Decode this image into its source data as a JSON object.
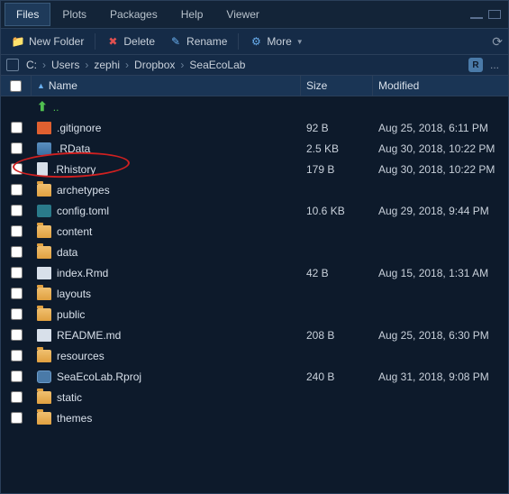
{
  "tabs": [
    "Files",
    "Plots",
    "Packages",
    "Help",
    "Viewer"
  ],
  "active_tab": 0,
  "toolbar": {
    "new_folder": "New Folder",
    "delete": "Delete",
    "rename": "Rename",
    "more": "More"
  },
  "breadcrumbs": [
    "C:",
    "Users",
    "zephi",
    "Dropbox",
    "SeaEcoLab"
  ],
  "columns": {
    "name": "Name",
    "size": "Size",
    "modified": "Modified"
  },
  "files": [
    {
      "name": "..",
      "type": "up",
      "size": "",
      "modified": ""
    },
    {
      "name": ".gitignore",
      "type": "git",
      "size": "92 B",
      "modified": "Aug 25, 2018, 6:11 PM"
    },
    {
      "name": ".RData",
      "type": "r",
      "size": "2.5 KB",
      "modified": "Aug 30, 2018, 10:22 PM"
    },
    {
      "name": ".Rhistory",
      "type": "file",
      "size": "179 B",
      "modified": "Aug 30, 2018, 10:22 PM"
    },
    {
      "name": "archetypes",
      "type": "folder",
      "size": "",
      "modified": ""
    },
    {
      "name": "config.toml",
      "type": "toml",
      "size": "10.6 KB",
      "modified": "Aug 29, 2018, 9:44 PM"
    },
    {
      "name": "content",
      "type": "folder",
      "size": "",
      "modified": ""
    },
    {
      "name": "data",
      "type": "folder",
      "size": "",
      "modified": ""
    },
    {
      "name": "index.Rmd",
      "type": "md",
      "size": "42 B",
      "modified": "Aug 15, 2018, 1:31 AM"
    },
    {
      "name": "layouts",
      "type": "folder",
      "size": "",
      "modified": ""
    },
    {
      "name": "public",
      "type": "folder",
      "size": "",
      "modified": ""
    },
    {
      "name": "README.md",
      "type": "md",
      "size": "208 B",
      "modified": "Aug 25, 2018, 6:30 PM"
    },
    {
      "name": "resources",
      "type": "folder",
      "size": "",
      "modified": ""
    },
    {
      "name": "SeaEcoLab.Rproj",
      "type": "rproj",
      "size": "240 B",
      "modified": "Aug 31, 2018, 9:08 PM"
    },
    {
      "name": "static",
      "type": "folder",
      "size": "",
      "modified": ""
    },
    {
      "name": "themes",
      "type": "folder",
      "size": "",
      "modified": ""
    }
  ]
}
